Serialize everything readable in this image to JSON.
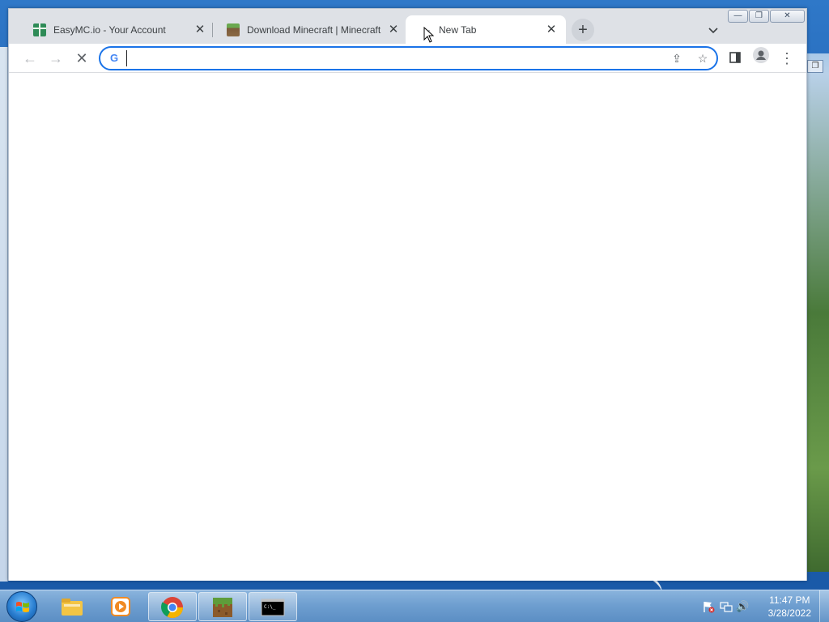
{
  "browser": {
    "tabs": [
      {
        "title": "EasyMC.io - Your Account",
        "icon": "gift-icon",
        "active": false
      },
      {
        "title": "Download Minecraft | Minecraft",
        "icon": "minecraft-grass-icon",
        "active": false
      },
      {
        "title": "New Tab",
        "icon": "loading-icon",
        "active": true
      }
    ],
    "tab_close_glyph": "✕",
    "new_tab_glyph": "+",
    "tab_search_glyph": "⌄",
    "window_controls": {
      "minimize": "—",
      "restore": "❐",
      "close": "✕"
    },
    "toolbar": {
      "back_glyph": "←",
      "forward_glyph": "→",
      "stop_glyph": "✕",
      "side_panel_glyph": "▯",
      "menu_glyph": "⋮"
    },
    "omnibox": {
      "value": "",
      "search_engine_icon": "G",
      "share_glyph": "⇪",
      "bookmark_glyph": "☆"
    }
  },
  "taskbar": {
    "apps": [
      {
        "name": "windows-explorer"
      },
      {
        "name": "media-player"
      },
      {
        "name": "google-chrome"
      },
      {
        "name": "minecraft-launcher"
      },
      {
        "name": "command-prompt",
        "label": "C:\\_"
      }
    ],
    "tray": {
      "time": "11:47 PM",
      "date": "3/28/2022",
      "volume_glyph": "🔊"
    }
  },
  "colors": {
    "accent": "#1a73e8",
    "tabstrip": "#dee1e6",
    "taskbar": "#6f9fd0"
  }
}
